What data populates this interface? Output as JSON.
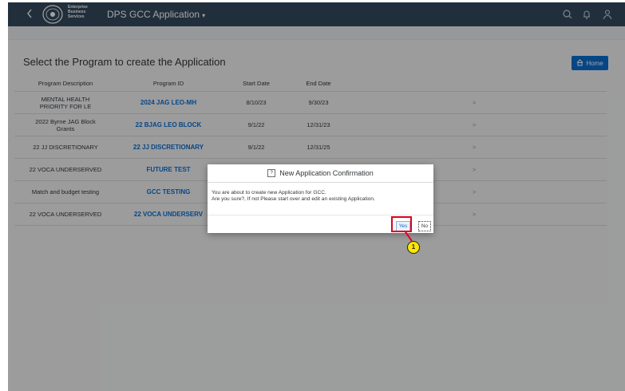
{
  "shell": {
    "brand_line1": "Enterprise",
    "brand_line2": "Business",
    "brand_line3": "Services",
    "app_title": "DPS GCC Application",
    "caret": "▾",
    "icons": [
      "back-icon",
      "search-icon",
      "bell-icon",
      "user-icon"
    ]
  },
  "page": {
    "heading": "Select the Program to create the Application",
    "home_label": "Home"
  },
  "table": {
    "columns": [
      "Program Description",
      "Program ID",
      "Start Date",
      "End Date"
    ],
    "rows": [
      {
        "desc": "MENTAL HEALTH PRIORITY FOR LE",
        "id": "2024 JAG LEO-MH",
        "start": "8/10/23",
        "end": "9/30/23"
      },
      {
        "desc": "2022 Byrne JAG Block Grants",
        "id": "22 BJAG LEO BLOCK",
        "start": "9/1/22",
        "end": "12/31/23"
      },
      {
        "desc": "22 JJ DISCRETIONARY",
        "id": "22 JJ DISCRETIONARY",
        "start": "9/1/22",
        "end": "12/31/25"
      },
      {
        "desc": "22 VOCA UNDERSERVED",
        "id": "FUTURE TEST",
        "start": "",
        "end": ""
      },
      {
        "desc": "Match and budget testing",
        "id": "GCC TESTING",
        "start": "",
        "end": ""
      },
      {
        "desc": "22 VOCA UNDERSERVED",
        "id": "22 VOCA UNDERSERV",
        "start": "",
        "end": ""
      }
    ],
    "nav_glyph": ">"
  },
  "dialog": {
    "icon_glyph": "?",
    "title": "New Application Confirmation",
    "line1": "You are about to create new Application for GCC.",
    "line2": "Are you sure?, If not Please start over and edit an existing Application.",
    "yes_label": "Yes",
    "no_label": "No"
  },
  "annotation": {
    "step": "1",
    "color": "#e0001b"
  },
  "colors": {
    "shell_bg": "#354a5f",
    "link_blue": "#0a6ed1",
    "callout_fill": "#ffe600"
  }
}
